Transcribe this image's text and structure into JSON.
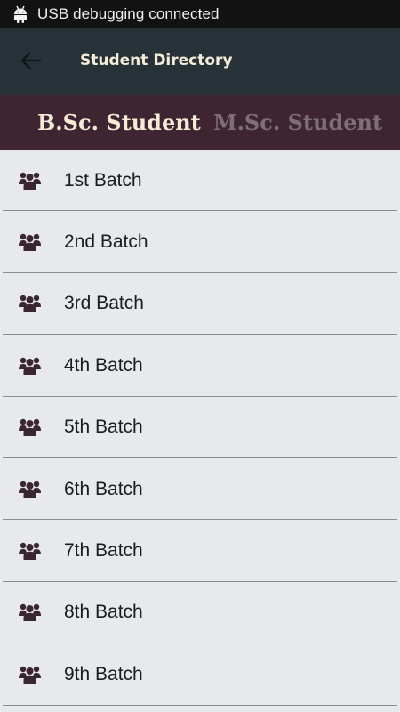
{
  "status_bar": {
    "icon": "android-debug-icon",
    "text": "USB debugging connected"
  },
  "app_bar": {
    "back_icon": "arrow-back-icon",
    "title": "Student Directory"
  },
  "tabs": [
    {
      "label": "B.Sc. Student",
      "active": true
    },
    {
      "label": "M.Sc. Student",
      "active": false
    }
  ],
  "batches": [
    {
      "label": "1st Batch",
      "icon": "group-icon"
    },
    {
      "label": "2nd Batch",
      "icon": "group-icon"
    },
    {
      "label": "3rd Batch",
      "icon": "group-icon"
    },
    {
      "label": "4th Batch",
      "icon": "group-icon"
    },
    {
      "label": "5th Batch",
      "icon": "group-icon"
    },
    {
      "label": "6th Batch",
      "icon": "group-icon"
    },
    {
      "label": "7th Batch",
      "icon": "group-icon"
    },
    {
      "label": "8th Batch",
      "icon": "group-icon"
    },
    {
      "label": "9th Batch",
      "icon": "group-icon"
    }
  ],
  "colors": {
    "status_bar": "#121212",
    "app_bar": "#263238",
    "tab_bar": "#3e2531",
    "tab_active_text": "#f5ecd5",
    "tab_inactive_text": "#7d6f73",
    "list_background": "#e8e9eb",
    "icon": "#3a2632"
  }
}
